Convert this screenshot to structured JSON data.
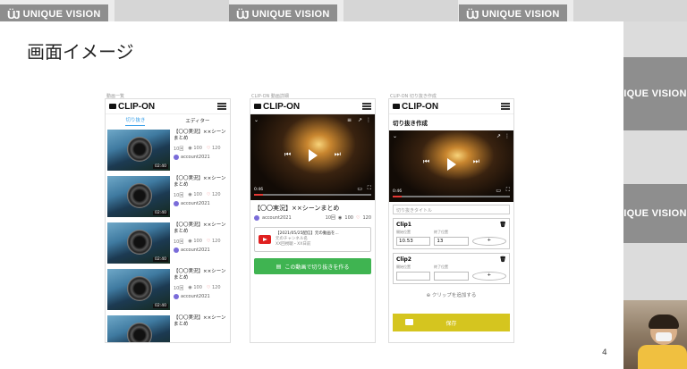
{
  "watermark": {
    "brand": "UNIQUE VISION",
    "brand_short": "IQUE VISION",
    "logo_glyph": "ÜJ"
  },
  "slide": {
    "title": "画面イメージ",
    "page_number": "4"
  },
  "captions": {
    "screen1": "動画一覧",
    "screen2": "CLIP-ON 動画詳細",
    "screen3": "CLIP-ON 切り抜き作成"
  },
  "app": {
    "brand": "CLIP-ON"
  },
  "screen1": {
    "tabs": [
      "切り抜き",
      "エディター"
    ],
    "items": [
      {
        "title": "【〇〇実況】××シーンまとめ",
        "views": "10回",
        "likes": "100",
        "hearts": "120",
        "account": "account2021",
        "duration": "02:40"
      },
      {
        "title": "【〇〇実況】××シーンまとめ",
        "views": "10回",
        "likes": "100",
        "hearts": "120",
        "account": "account2021",
        "duration": "02:40"
      },
      {
        "title": "【〇〇実況】××シーンまとめ",
        "views": "10回",
        "likes": "100",
        "hearts": "120",
        "account": "account2021",
        "duration": "02:40"
      },
      {
        "title": "【〇〇実況】××シーンまとめ",
        "views": "10回",
        "likes": "100",
        "hearts": "120",
        "account": "account2021",
        "duration": "02:40"
      },
      {
        "title": "【〇〇実況】××シーンまとめ",
        "views": "",
        "likes": "",
        "hearts": "",
        "account": "",
        "duration": ""
      }
    ]
  },
  "screen2": {
    "player_time": "0:46",
    "video_title": "【〇〇実況】××シーンまとめ",
    "account": "account2021",
    "views": "10回",
    "likes": "100",
    "hearts": "120",
    "yt_card_title": "【2021/05/25配信】元の動画を...",
    "yt_card_line2": "元のチャンネル名",
    "yt_card_line3": "XX回視聴・XX日前",
    "clip_button": "この動画で切り抜きを作る"
  },
  "screen3": {
    "section_title": "切り抜き作成",
    "player_time": "0:46",
    "title_placeholder": "切り抜きタイトル",
    "clips": [
      {
        "name": "Clip1",
        "start_label": "開始位置",
        "end_label": "終了位置",
        "start": "10.53",
        "end": "13"
      },
      {
        "name": "Clip2",
        "start_label": "開始位置",
        "end_label": "終了位置",
        "start": "",
        "end": ""
      }
    ],
    "add_clip": "クリップを追加する",
    "save": "保存"
  }
}
